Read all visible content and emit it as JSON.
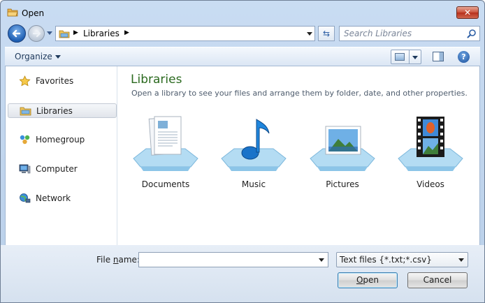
{
  "window": {
    "title": "Open",
    "close_glyph": "✕"
  },
  "nav": {
    "breadcrumb": [
      "Libraries"
    ],
    "search_placeholder": "Search Libraries",
    "refresh_glyph": "⇆"
  },
  "toolbar": {
    "organize_label": "Organize",
    "help_glyph": "?"
  },
  "sidebar": {
    "items": [
      {
        "label": "Favorites",
        "icon": "star-icon"
      },
      {
        "label": "Libraries",
        "icon": "library-folder-icon",
        "selected": true
      },
      {
        "label": "Homegroup",
        "icon": "homegroup-icon"
      },
      {
        "label": "Computer",
        "icon": "computer-icon"
      },
      {
        "label": "Network",
        "icon": "network-icon"
      }
    ]
  },
  "content": {
    "title": "Libraries",
    "subtitle": "Open a library to see your files and arrange them by folder, date, and other properties.",
    "libraries": [
      {
        "label": "Documents",
        "icon": "documents-library-icon"
      },
      {
        "label": "Music",
        "icon": "music-library-icon"
      },
      {
        "label": "Pictures",
        "icon": "pictures-library-icon"
      },
      {
        "label": "Videos",
        "icon": "videos-library-icon"
      }
    ]
  },
  "footer": {
    "file_name_label_pre": "File ",
    "file_name_label_u": "n",
    "file_name_label_post": "ame:",
    "file_name_value": "",
    "filter_value": "Text files {*.txt;*.csv}",
    "open_label_u": "O",
    "open_label_rest": "pen",
    "cancel_label": "Cancel"
  },
  "colors": {
    "title_green": "#2b6a1f",
    "frame_blue": "#c9dcf2",
    "close_red": "#c9503a"
  }
}
